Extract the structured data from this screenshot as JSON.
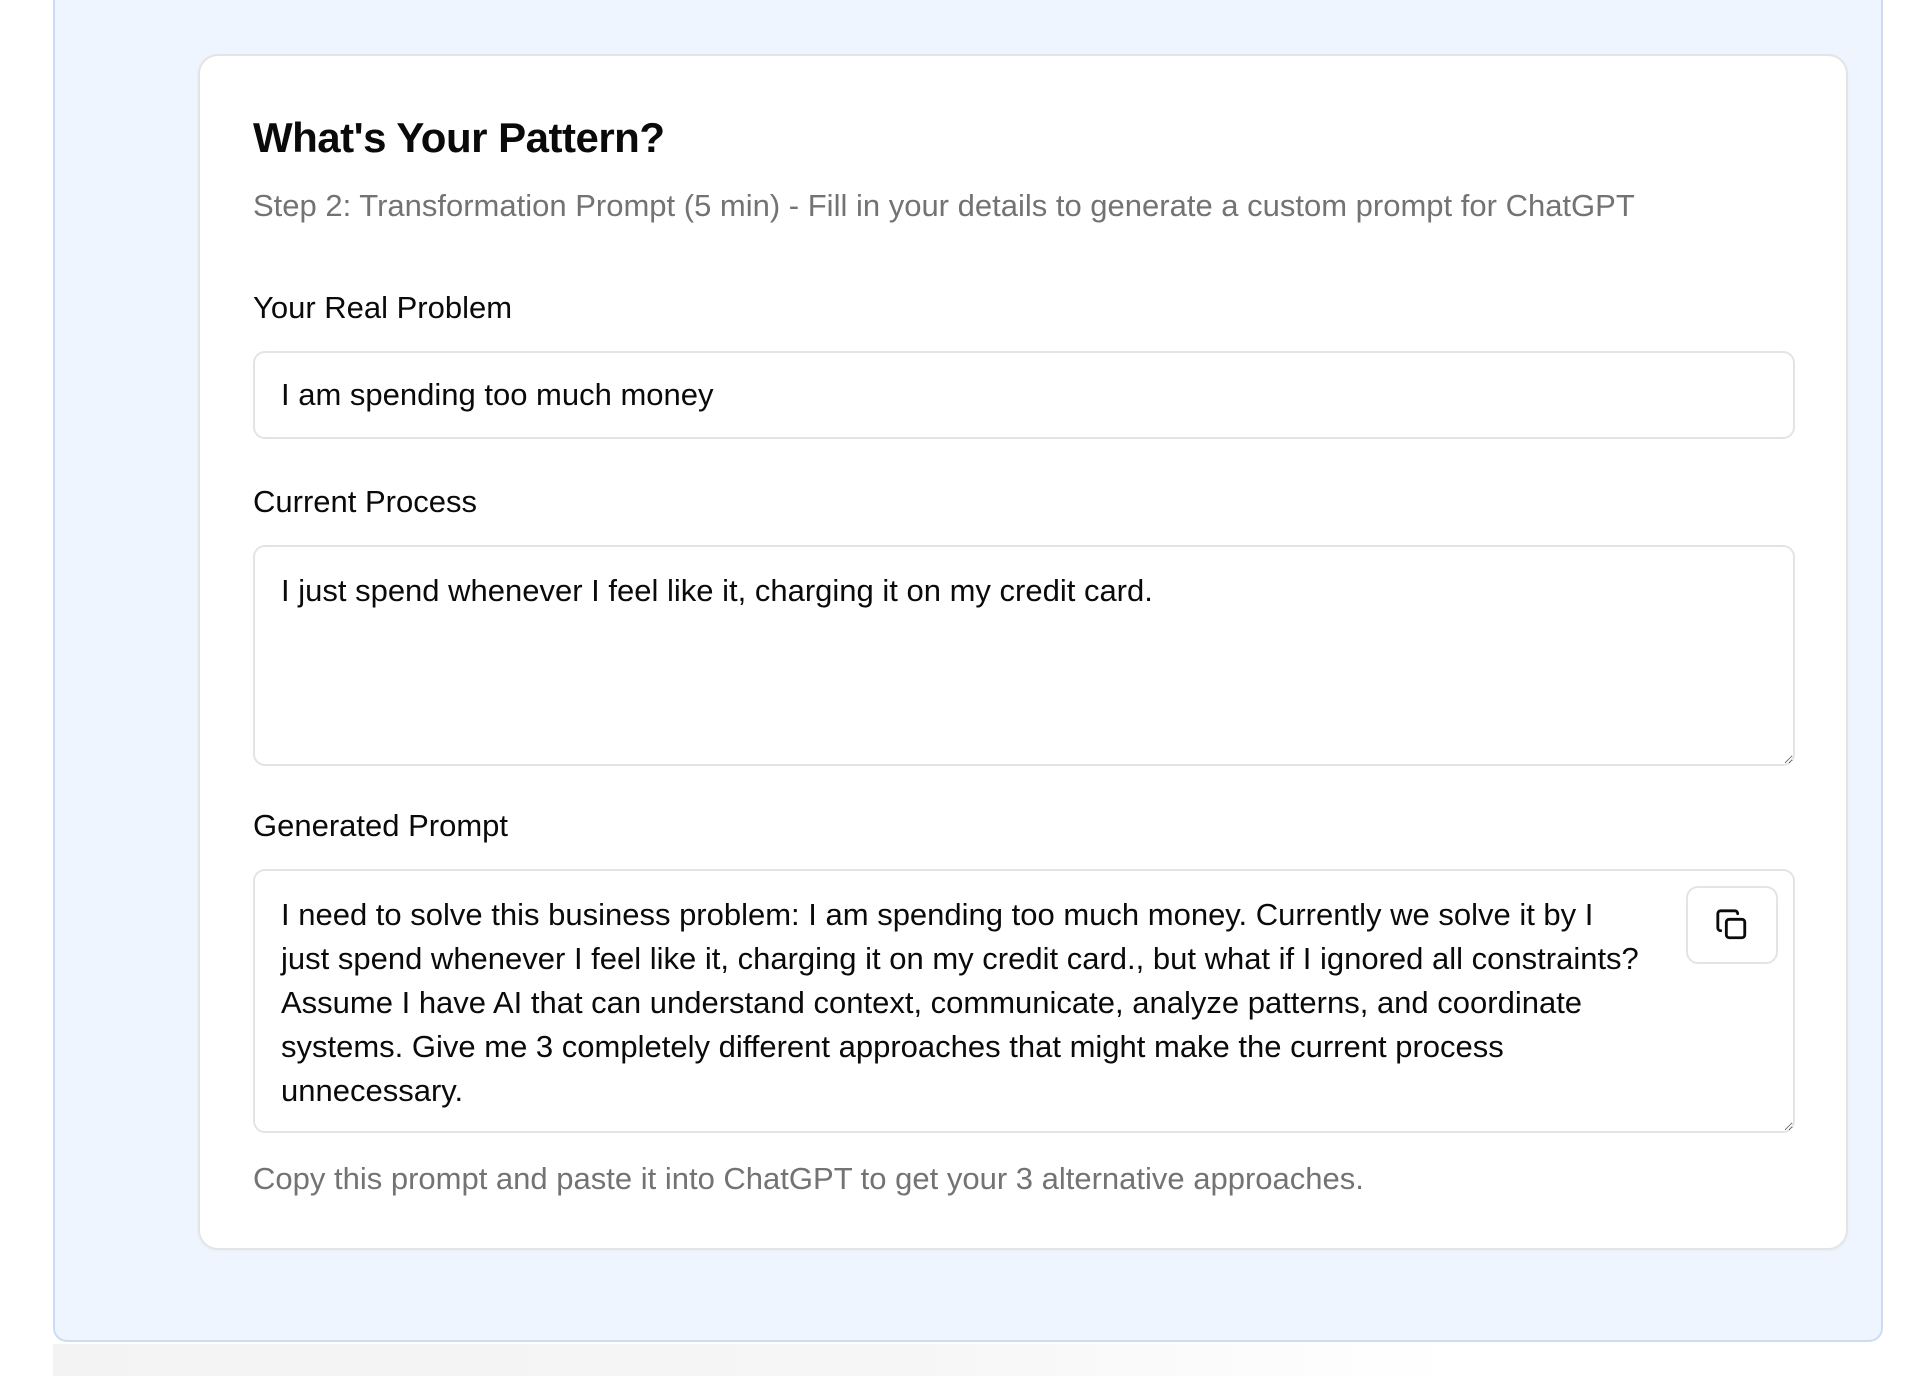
{
  "card": {
    "title": "What's Your Pattern?",
    "subtitle": "Step 2: Transformation Prompt (5 min) - Fill in your details to generate a custom prompt for ChatGPT"
  },
  "fields": {
    "real_problem": {
      "label": "Your Real Problem",
      "value": "I am spending too much money"
    },
    "current_process": {
      "label": "Current Process",
      "value": "I just spend whenever I feel like it, charging it on my credit card."
    },
    "generated_prompt": {
      "label": "Generated Prompt",
      "value": "I need to solve this business problem: I am spending too much money. Currently we solve it by I just spend whenever I feel like it, charging it on my credit card., but what if I ignored all constraints? Assume I have AI that can understand context, communicate, analyze patterns, and coordinate systems. Give me 3 completely different approaches that might make the current process unnecessary.",
      "copy_icon": "copy-icon"
    }
  },
  "helper_text": "Copy this prompt and paste it into ChatGPT to get your 3 alternative approaches.",
  "colors": {
    "page_background": "#ffffff",
    "panel_background": "#eef5fe",
    "panel_border": "#c9ddf6",
    "card_border": "#e4e4e7",
    "muted_text": "#737373",
    "primary_text": "#0a0a0a"
  }
}
